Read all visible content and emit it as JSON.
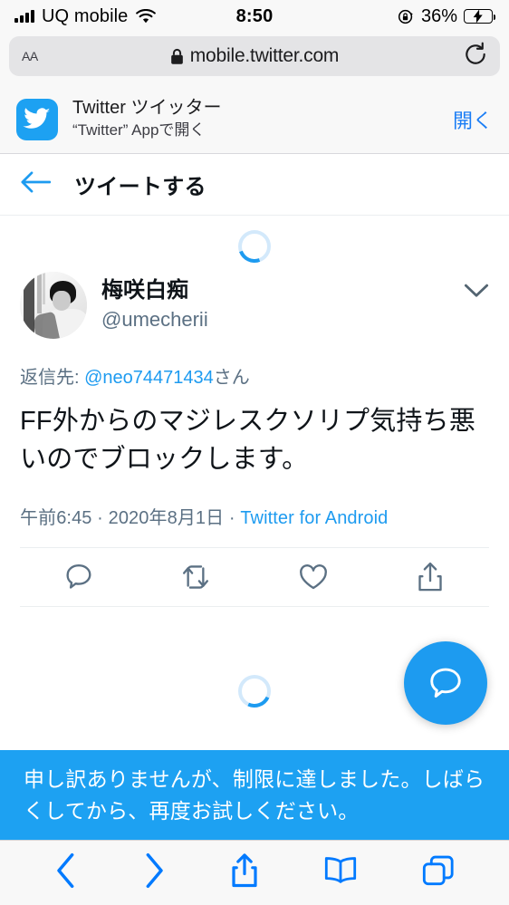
{
  "status_bar": {
    "carrier": "UQ mobile",
    "time": "8:50",
    "battery_percent": "36%",
    "signal_icon": "signal-bars-icon",
    "wifi_icon": "wifi-icon",
    "rotation_lock_icon": "rotation-lock-icon",
    "battery_icon": "battery-charging-icon"
  },
  "browser": {
    "text_size_label": "AA",
    "url": "mobile.twitter.com",
    "lock_icon": "lock-icon",
    "reload_icon": "reload-icon"
  },
  "app_banner": {
    "icon": "twitter-bird-icon",
    "title": "Twitter ツイッター",
    "subtitle": "“Twitter” Appで開く",
    "open_label": "開く"
  },
  "header": {
    "back_icon": "back-arrow-icon",
    "title": "ツイートする"
  },
  "tweet": {
    "avatar": "user-avatar",
    "display_name": "梅咲白痴",
    "handle": "@umecherii",
    "menu_icon": "chevron-down-icon",
    "reply_prefix": "返信先: ",
    "reply_to_handle": "@neo74471434",
    "reply_suffix": "さん",
    "text": "FF外からのマジレスクソリプ気持ち悪いのでブロックします。",
    "time": "午前6:45 · 2020年8月1日 · ",
    "client": "Twitter for Android",
    "actions": [
      {
        "name": "reply-icon"
      },
      {
        "name": "retweet-icon"
      },
      {
        "name": "like-icon"
      },
      {
        "name": "share-icon"
      }
    ]
  },
  "compose_fab": {
    "icon": "compose-tweet-icon"
  },
  "loading": {
    "spinner_icon": "loading-spinner"
  },
  "error_banner": {
    "message": "申し訳ありませんが、制限に達しました。しばらくしてから、再度お試しください。"
  },
  "toolbar": {
    "items": [
      {
        "name": "browser-back-icon"
      },
      {
        "name": "browser-forward-icon"
      },
      {
        "name": "browser-share-icon"
      },
      {
        "name": "bookmarks-icon"
      },
      {
        "name": "tabs-icon"
      }
    ]
  },
  "colors": {
    "twitter_blue": "#1DA1F2",
    "link_blue": "#1D9BF0",
    "ios_blue": "#007AFF",
    "text_primary": "#0F1419",
    "text_secondary": "#5B7083"
  }
}
